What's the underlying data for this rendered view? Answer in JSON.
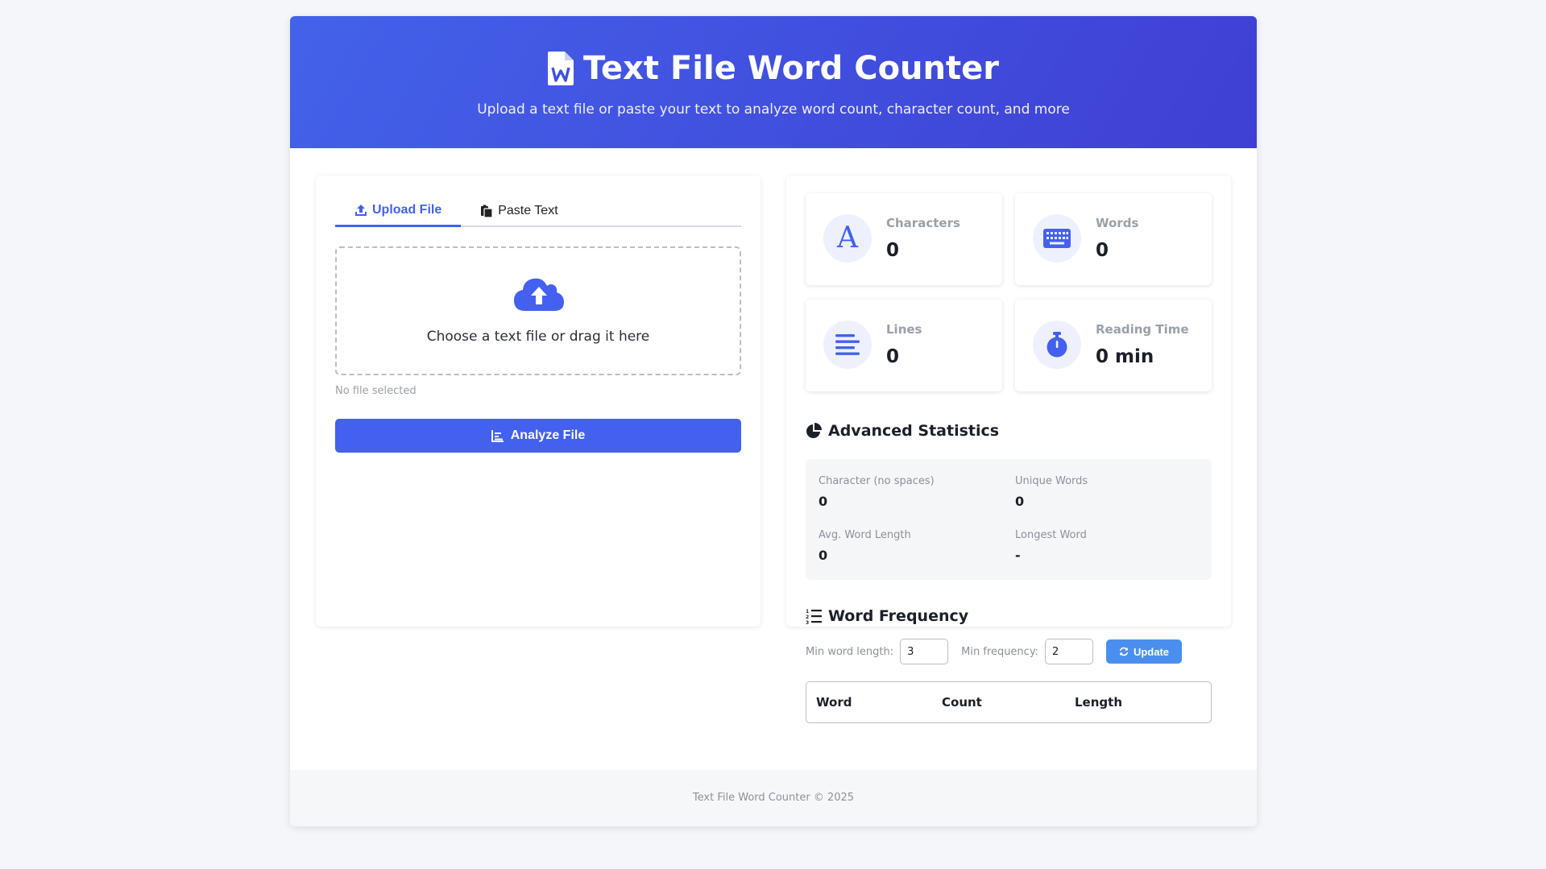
{
  "header": {
    "title": "Text File Word Counter",
    "subtitle": "Upload a text file or paste your text to analyze word count, character count, and more"
  },
  "tabs": [
    {
      "label": "Upload File",
      "icon": "upload-icon",
      "active": true
    },
    {
      "label": "Paste Text",
      "icon": "paste-icon",
      "active": false
    }
  ],
  "upload": {
    "dropzone_text": "Choose a text file or drag it here",
    "file_status": "No file selected",
    "analyze_label": "Analyze File"
  },
  "stats": [
    {
      "label": "Characters",
      "value": "0",
      "icon": "letter-a-icon"
    },
    {
      "label": "Words",
      "value": "0",
      "icon": "keyboard-icon"
    },
    {
      "label": "Lines",
      "value": "0",
      "icon": "lines-icon"
    },
    {
      "label": "Reading Time",
      "value": "0 min",
      "icon": "stopwatch-icon"
    }
  ],
  "advanced": {
    "title": "Advanced Statistics",
    "items": [
      {
        "label": "Character (no spaces)",
        "value": "0"
      },
      {
        "label": "Unique Words",
        "value": "0"
      },
      {
        "label": "Avg. Word Length",
        "value": "0"
      },
      {
        "label": "Longest Word",
        "value": "-"
      }
    ]
  },
  "frequency": {
    "title": "Word Frequency",
    "min_length_label": "Min word length:",
    "min_length_value": "3",
    "min_freq_label": "Min frequency:",
    "min_freq_value": "2",
    "update_label": "Update",
    "columns": [
      "Word",
      "Count",
      "Length"
    ]
  },
  "footer": {
    "text": "Text File Word Counter © 2025"
  },
  "colors": {
    "accent": "#4361ee",
    "update_button": "#4a8ff0",
    "header_gradient_start": "#4362ea",
    "header_gradient_end": "#3f3fd3"
  }
}
